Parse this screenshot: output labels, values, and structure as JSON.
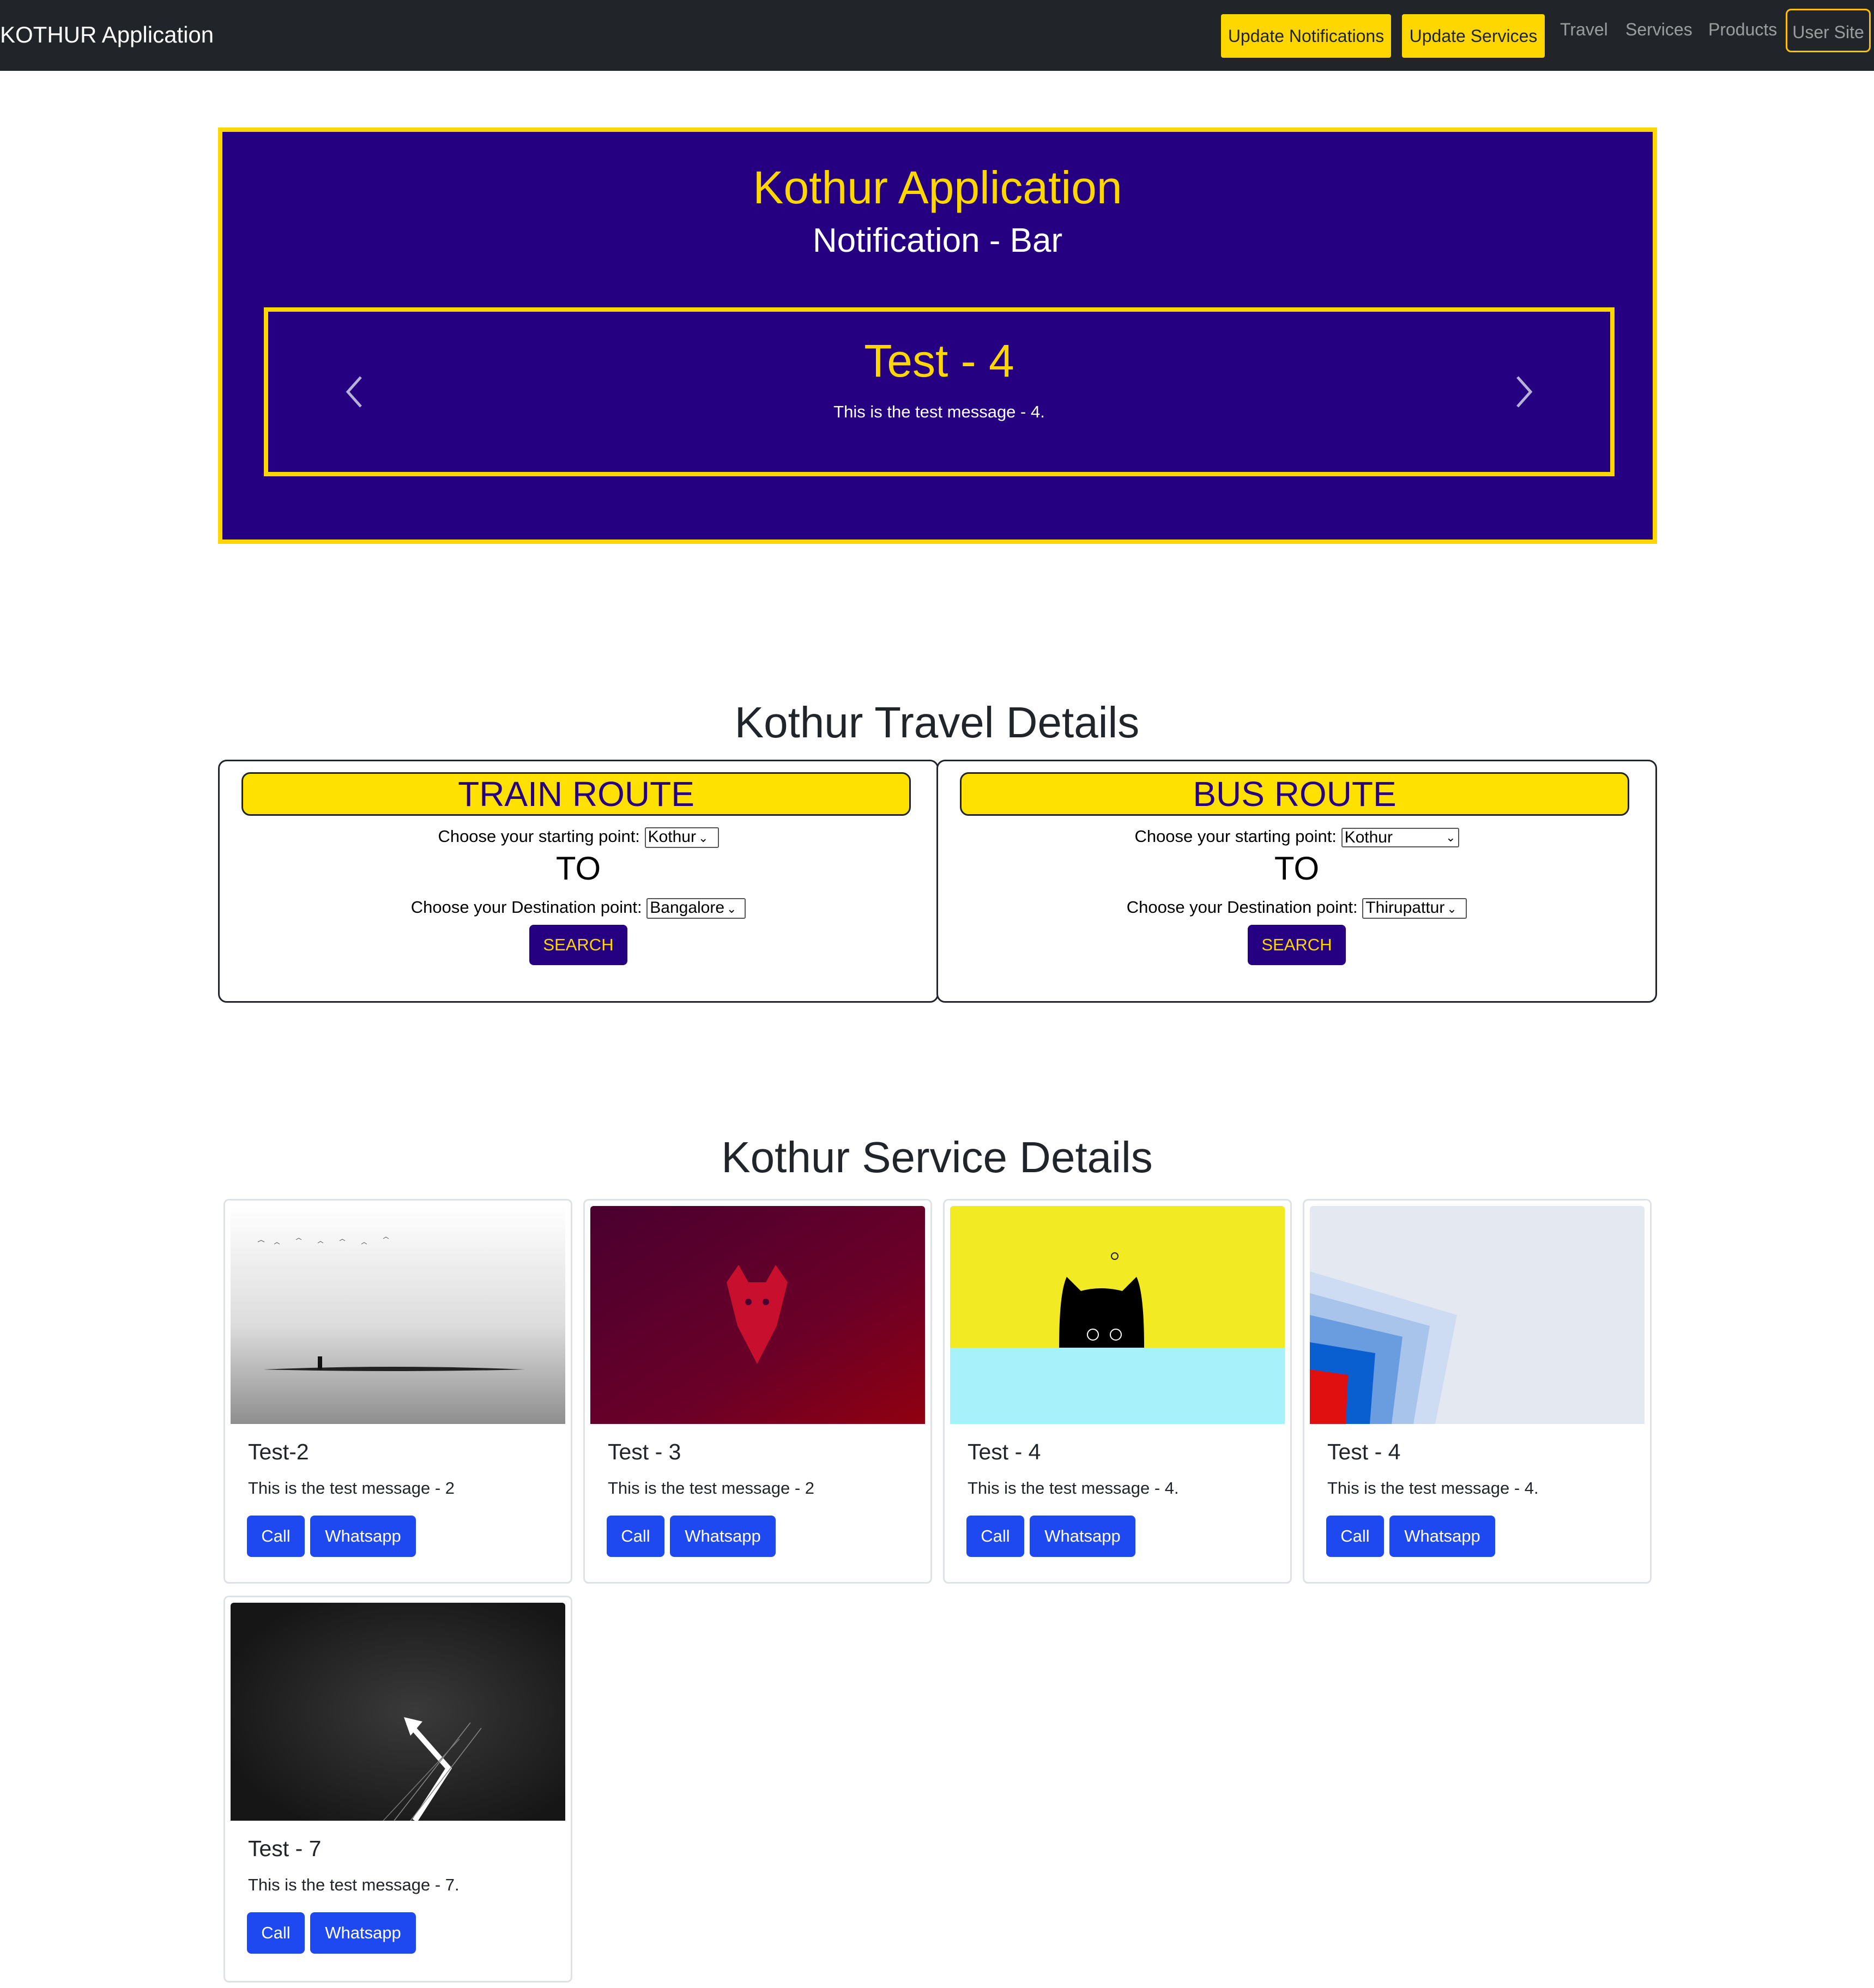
{
  "navbar": {
    "brand": "KOTHUR Application",
    "update_notifications": "Update Notifications",
    "update_services": "Update Services",
    "links": [
      "Travel",
      "Services",
      "Products"
    ],
    "user_site": "User Site"
  },
  "notification": {
    "title": "Kothur Application",
    "subtitle": "Notification - Bar",
    "slide": {
      "title": "Test - 4",
      "text": "This is the test message - 4."
    }
  },
  "travel": {
    "title": "Kothur Travel Details",
    "train": {
      "heading": "TRAIN ROUTE",
      "start_label": "Choose your starting point:",
      "start_value": "Kothur",
      "to": "TO",
      "dest_label": "Choose your Destination point:",
      "dest_value": "Bangalore",
      "search": "SEARCH"
    },
    "bus": {
      "heading": "BUS ROUTE",
      "start_label": "Choose your starting point:",
      "start_value": "Kothur",
      "to": "TO",
      "dest_label": "Choose your Destination point:",
      "dest_value": "Thirupattur",
      "search": "SEARCH"
    }
  },
  "services": {
    "title": "Kothur Service Details",
    "cards": [
      {
        "title": "Test-2",
        "text": "This is the test message - 2",
        "image": "foggy-lake-image",
        "call": "Call",
        "whatsapp": "Whatsapp"
      },
      {
        "title": "Test - 3",
        "text": "This is the test message - 2",
        "image": "red-wolf-image",
        "call": "Call",
        "whatsapp": "Whatsapp"
      },
      {
        "title": "Test - 4",
        "text": "This is the test message - 4.",
        "image": "black-cat-image",
        "call": "Call",
        "whatsapp": "Whatsapp"
      },
      {
        "title": "Test - 4",
        "text": "This is the test message - 4.",
        "image": "abstract-squares-image",
        "call": "Call",
        "whatsapp": "Whatsapp"
      },
      {
        "title": "Test - 7",
        "text": "This is the test message - 7.",
        "image": "dark-arrow-image",
        "call": "Call",
        "whatsapp": "Whatsapp"
      }
    ]
  },
  "colors": {
    "navbar": "#212529",
    "accent_yellow": "#ffd700",
    "notification_bg": "#250080",
    "button_blue": "#1e48f0"
  }
}
